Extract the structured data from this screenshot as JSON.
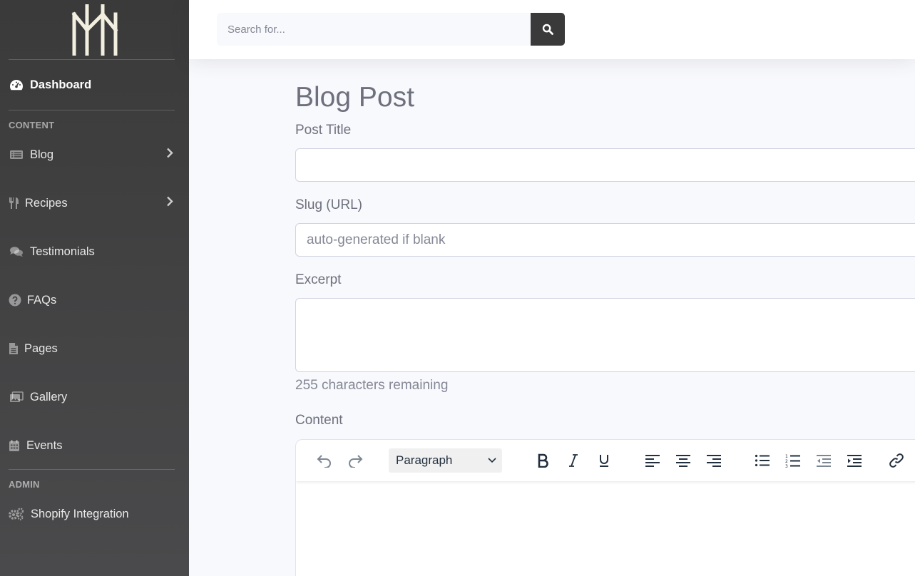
{
  "sidebar": {
    "dashboard_label": "Dashboard",
    "section_content": "CONTENT",
    "section_admin": "ADMIN",
    "items": [
      {
        "label": "Blog",
        "icon": "list-alt-icon",
        "has_chevron": true
      },
      {
        "label": "Recipes",
        "icon": "utensils-icon",
        "has_chevron": true
      },
      {
        "label": "Testimonials",
        "icon": "comments-icon",
        "has_chevron": false
      },
      {
        "label": "FAQs",
        "icon": "question-circle-icon",
        "has_chevron": false
      },
      {
        "label": "Pages",
        "icon": "file-icon",
        "has_chevron": false
      },
      {
        "label": "Gallery",
        "icon": "images-icon",
        "has_chevron": false
      },
      {
        "label": "Events",
        "icon": "calendar-icon",
        "has_chevron": false
      }
    ],
    "admin_items": [
      {
        "label": "Shopify Integration",
        "icon": "cogs-icon"
      }
    ]
  },
  "search": {
    "placeholder": "Search for..."
  },
  "form": {
    "title": "Blog Post",
    "post_title_label": "Post Title",
    "slug_label": "Slug (URL)",
    "slug_placeholder": "auto-generated if blank",
    "excerpt_label": "Excerpt",
    "excerpt_hint": "255 characters remaining",
    "content_label": "Content"
  },
  "editor": {
    "block_format": "Paragraph"
  },
  "colors": {
    "sidebar_bg": "#3a3a3a",
    "search_button": "#3a3a3a",
    "page_bg": "#f8f9fc",
    "text": "#6e707e"
  }
}
